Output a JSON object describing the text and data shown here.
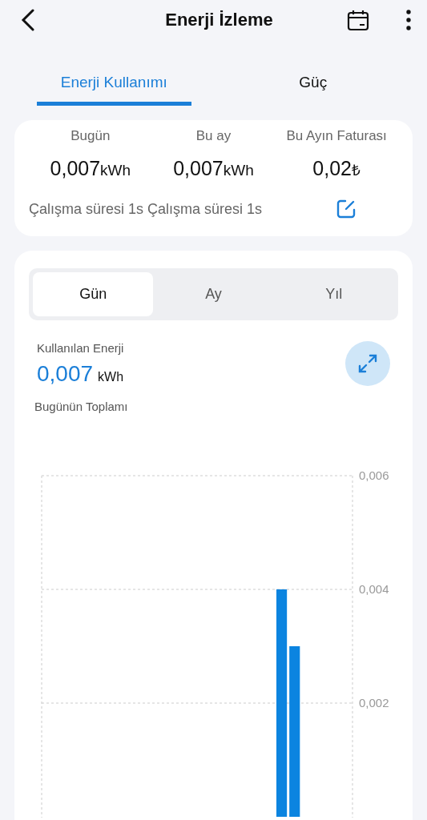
{
  "header": {
    "title": "Enerji İzleme"
  },
  "tabs": [
    {
      "label": "Enerji Kullanımı",
      "selected": true
    },
    {
      "label": "Güç",
      "selected": false
    }
  ],
  "summary": {
    "stats": [
      {
        "label": "Bugün",
        "value": "0,007",
        "unit": "kWh"
      },
      {
        "label": "Bu ay",
        "value": "0,007",
        "unit": "kWh"
      },
      {
        "label": "Bu Ayın Faturası",
        "value": "0,02",
        "unit": "₺"
      }
    ],
    "runtime": "Çalışma süresi 1s Çalışma süresi 1s"
  },
  "period_tabs": [
    {
      "label": "Gün",
      "selected": true
    },
    {
      "label": "Ay",
      "selected": false
    },
    {
      "label": "Yıl",
      "selected": false
    }
  ],
  "usage": {
    "label": "Kullanılan Enerji",
    "value": "0,007",
    "unit": "kWh",
    "caption": "Bugünün Toplamı"
  },
  "chart_data": {
    "type": "bar",
    "ylim": [
      0,
      0.006
    ],
    "yticks": [
      {
        "value": 0.006,
        "label": "0,006"
      },
      {
        "value": 0.004,
        "label": "0,004"
      },
      {
        "value": 0.002,
        "label": "0,002"
      }
    ],
    "series": [
      {
        "color": "#0b84e0",
        "values": [
          0,
          0,
          0,
          0,
          0,
          0,
          0,
          0,
          0,
          0,
          0,
          0,
          0,
          0,
          0,
          0,
          0,
          0,
          0.004,
          0.003,
          0,
          0,
          0,
          0
        ]
      }
    ]
  }
}
